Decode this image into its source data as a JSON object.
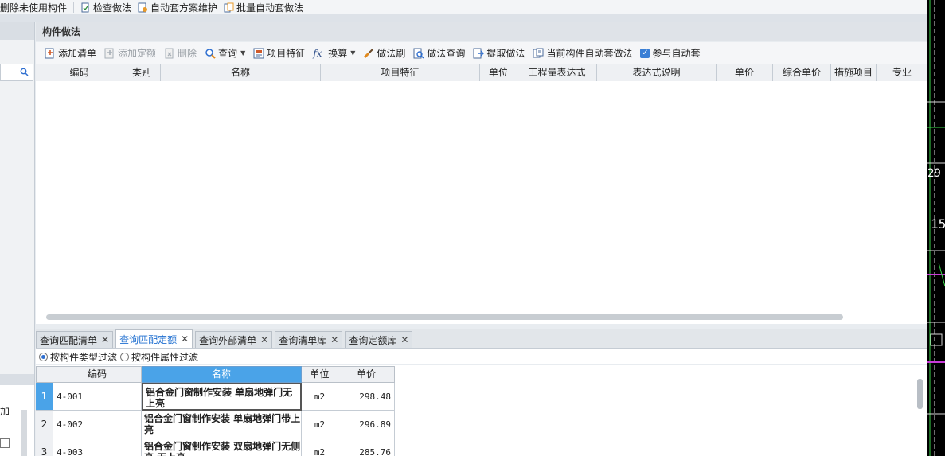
{
  "top_toolbar": {
    "items": [
      {
        "label": "删除未使用构件",
        "icon": "delete-unused-icon"
      },
      {
        "label": "检查做法",
        "icon": "check-method-icon"
      },
      {
        "label": "自动套方案维护",
        "icon": "auto-scheme-icon"
      },
      {
        "label": "批量自动套做法",
        "icon": "batch-auto-icon"
      }
    ]
  },
  "left_panel": {
    "add_label": "加"
  },
  "main": {
    "title": "构件做法",
    "toolbar": [
      {
        "label": "添加清单",
        "icon": "add-list-icon",
        "enabled": true
      },
      {
        "label": "添加定额",
        "icon": "add-quota-icon",
        "enabled": false
      },
      {
        "label": "删除",
        "icon": "delete-icon",
        "enabled": false
      },
      {
        "label": "查询",
        "icon": "query-icon",
        "enabled": true,
        "dropdown": true
      },
      {
        "label": "项目特征",
        "icon": "project-feature-icon",
        "enabled": true
      },
      {
        "label": "换算",
        "icon": "fx-icon",
        "enabled": true,
        "dropdown": true
      },
      {
        "label": "做法刷",
        "icon": "brush-icon",
        "enabled": true
      },
      {
        "label": "做法查询",
        "icon": "method-query-icon",
        "enabled": true
      },
      {
        "label": "提取做法",
        "icon": "extract-method-icon",
        "enabled": true
      },
      {
        "label": "当前构件自动套做法",
        "icon": "auto-apply-icon",
        "enabled": true
      }
    ],
    "auto_checkbox": {
      "label": "参与自动套",
      "checked": true
    },
    "columns": [
      "编码",
      "类别",
      "名称",
      "项目特征",
      "单位",
      "工程量表达式",
      "表达式说明",
      "单价",
      "综合单价",
      "措施项目",
      "专业"
    ]
  },
  "bottom": {
    "tabs": [
      {
        "label": "查询匹配清单",
        "active": false
      },
      {
        "label": "查询匹配定额",
        "active": true
      },
      {
        "label": "查询外部清单",
        "active": false
      },
      {
        "label": "查询清单库",
        "active": false
      },
      {
        "label": "查询定额库",
        "active": false
      }
    ],
    "filters": [
      {
        "label": "按构件类型过滤",
        "selected": true
      },
      {
        "label": "按构件属性过滤",
        "selected": false
      }
    ],
    "quota_columns": [
      "编码",
      "名称",
      "单位",
      "单价"
    ],
    "quota_rows": [
      {
        "num": "1",
        "code": "4-001",
        "name": "铝合金门窗制作安装 单扇地弹门无上亮",
        "unit": "m2",
        "price": "298.48"
      },
      {
        "num": "2",
        "code": "4-002",
        "name": "铝合金门窗制作安装 单扇地弹门带上亮",
        "unit": "m2",
        "price": "296.89"
      },
      {
        "num": "3",
        "code": "4-003",
        "name": "铝合金门窗制作安装 双扇地弹门无侧亮 无上亮",
        "unit": "m2",
        "price": "285.76"
      }
    ]
  },
  "cad": {
    "labels": [
      "29",
      "15"
    ]
  }
}
